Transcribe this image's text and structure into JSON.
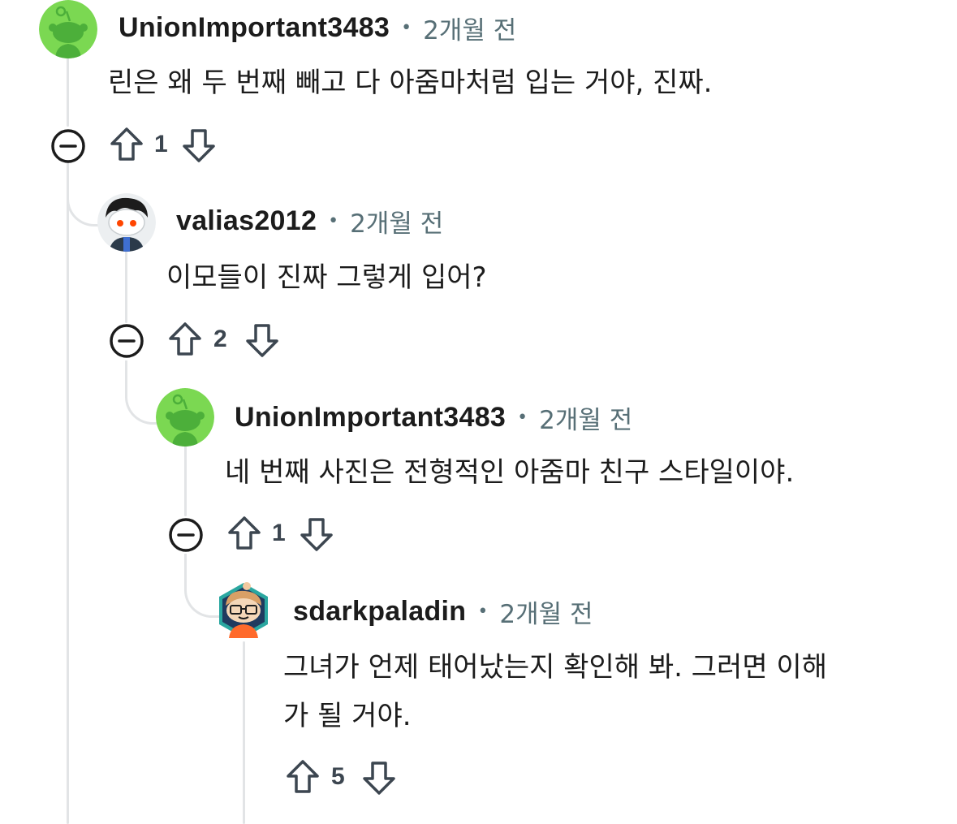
{
  "comments": [
    {
      "username": "UnionImportant3483",
      "separator": "•",
      "time": "2개월 전",
      "text": "린은 왜 두 번째 빼고 다 아줌마처럼 입는 거야, 진짜.",
      "score": "1",
      "avatar": "snoo-green-icon"
    },
    {
      "username": "valias2012",
      "separator": "•",
      "time": "2개월 전",
      "text": "이모들이 진짜 그렇게 입어?",
      "score": "2",
      "avatar": "snoo-gray-curly-hair-icon"
    },
    {
      "username": "UnionImportant3483",
      "separator": "•",
      "time": "2개월 전",
      "text": "네 번째 사진은 전형적인 아줌마 친구 스타일이야.",
      "score": "1",
      "avatar": "snoo-green-icon"
    },
    {
      "username": "sdarkpaladin",
      "separator": "•",
      "time": "2개월 전",
      "text_line1": "그녀가 언제 태어났는지 확인해 봐. 그러면 이해",
      "text_line2": "가 될 거야.",
      "score": "5",
      "avatar": "snoo-glasses-hexagon-icon"
    }
  ],
  "icons": {
    "collapse": "minus-circle-icon",
    "upvote": "arrow-up-outline-icon",
    "downvote": "arrow-down-outline-icon"
  },
  "colors": {
    "thread_line": "#e2e4e6",
    "meta_gray": "#576f76",
    "snoo_green": "#7bd852",
    "snoo_green_dark": "#4caf3a"
  }
}
